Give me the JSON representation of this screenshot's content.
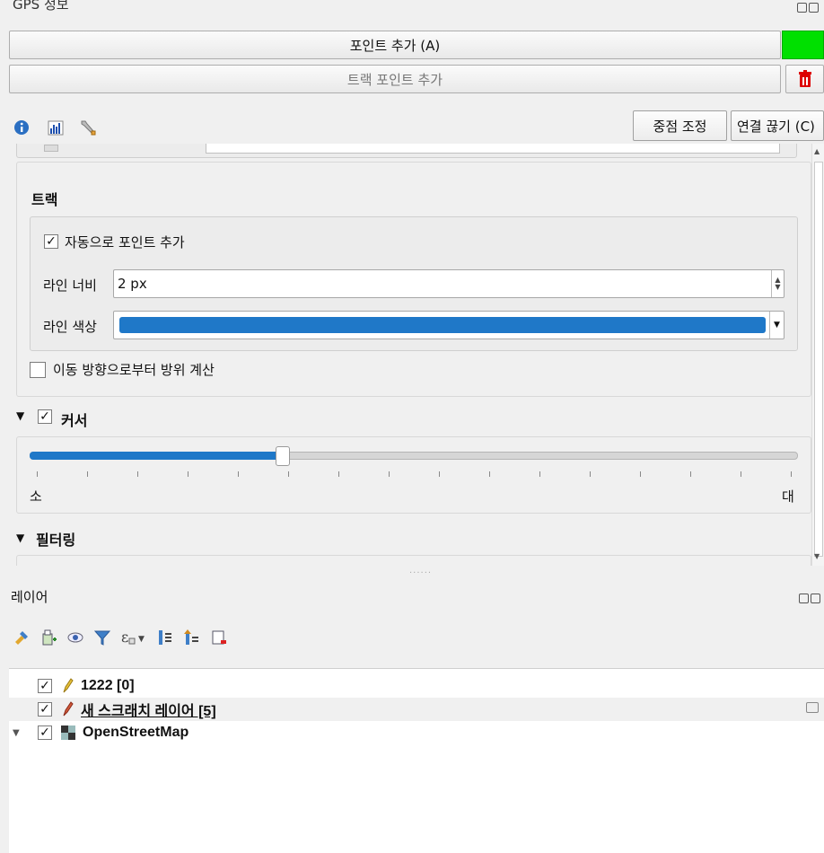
{
  "gps_panel": {
    "title": "GPS 정보",
    "add_point_label": "포인트 추가 (A)",
    "add_track_point_label": "트랙 포인트 추가",
    "recenter_label": "중점 조정",
    "disconnect_label": "연결 끊기 (C)",
    "track_section_title": "트랙",
    "auto_add_points_label": "자동으로 포인트 추가",
    "auto_add_points_checked": true,
    "line_width_label": "라인 너비",
    "line_width_value": "2 px",
    "line_color_label": "라인 색상",
    "line_color_value": "#1f78c8",
    "bearing_from_movement_label": "이동 방향으로부터 방위 계산",
    "bearing_from_movement_checked": false,
    "cursor_section_title": "커서",
    "cursor_enabled": true,
    "cursor_size_fraction": 0.33,
    "cursor_min_label": "소",
    "cursor_max_label": "대",
    "filtering_section_title": "필터링",
    "status_color": "#00e000"
  },
  "layers_panel": {
    "title": "레이어",
    "layers": [
      {
        "name": "1222 [0]",
        "checked": true,
        "icon": "pencil-icon",
        "expand": ""
      },
      {
        "name": "새 스크래치 레이어 [5]",
        "checked": true,
        "icon": "pencil-icon",
        "expand": ""
      },
      {
        "name": "OpenStreetMap",
        "checked": true,
        "icon": "raster-tile-icon",
        "expand": "▼"
      }
    ]
  }
}
